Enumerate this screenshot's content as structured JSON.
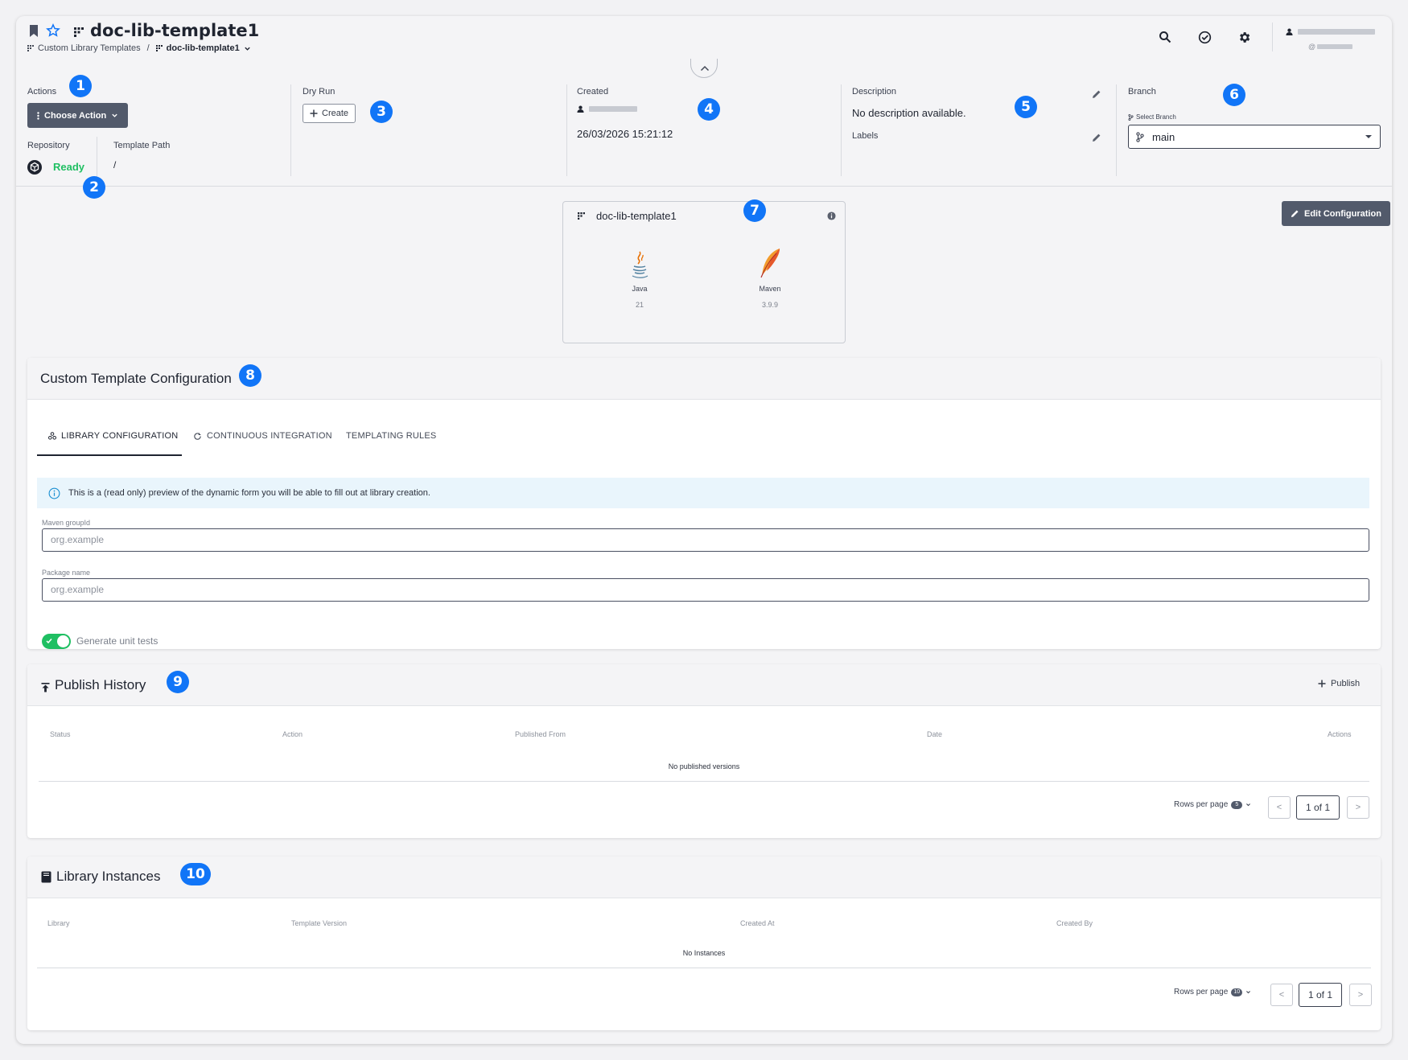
{
  "header": {
    "title": "doc-lib-template1",
    "breadcrumb": {
      "parent": "Custom Library Templates",
      "separator": "/",
      "current": "doc-lib-template1"
    },
    "user_handle": "@"
  },
  "markers": [
    "1",
    "2",
    "3",
    "4",
    "5",
    "6",
    "7",
    "8",
    "9",
    "10"
  ],
  "info_bar": {
    "actions_label": "Actions",
    "choose_action": "Choose Action",
    "repository_label": "Repository",
    "repository_status": "Ready",
    "template_path_label": "Template Path",
    "template_path": "/",
    "dry_run_label": "Dry Run",
    "dry_run_button": "Create",
    "created_label": "Created",
    "created_at": "26/03/2026 15:21:12",
    "description_label": "Description",
    "description": "No description available.",
    "labels_label": "Labels",
    "branch_label": "Branch",
    "select_branch_label": "Select Branch",
    "branch": "main"
  },
  "template_card": {
    "name": "doc-lib-template1",
    "tech": [
      {
        "name": "Java",
        "version": "21"
      },
      {
        "name": "Maven",
        "version": "3.9.9"
      }
    ],
    "edit_button": "Edit Configuration"
  },
  "configuration": {
    "title": "Custom Template Configuration",
    "tabs": [
      "LIBRARY CONFIGURATION",
      "CONTINUOUS INTEGRATION",
      "TEMPLATING RULES"
    ],
    "active_tab": "LIBRARY CONFIGURATION",
    "info_text": "This is a (read only) preview of the dynamic form you will be able to fill out at library creation.",
    "fields": [
      {
        "label": "Maven groupId",
        "placeholder": "org.example"
      },
      {
        "label": "Package name",
        "placeholder": "org.example"
      }
    ],
    "toggle_label": "Generate unit tests",
    "toggle_on": true
  },
  "publish_history": {
    "title": "Publish History",
    "publish_button": "Publish",
    "columns": [
      "Status",
      "Action",
      "Published From",
      "Date",
      "Actions"
    ],
    "empty_text": "No published versions",
    "rows_per_page_label": "Rows per page",
    "rows_per_page": "5",
    "page": "1 of 1",
    "prev": "<",
    "next": ">"
  },
  "library_instances": {
    "title": "Library Instances",
    "columns": [
      "Library",
      "Template Version",
      "Created At",
      "Created By"
    ],
    "empty_text": "No Instances",
    "rows_per_page_label": "Rows per page",
    "rows_per_page": "10",
    "page": "1 of 1",
    "prev": "<",
    "next": ">"
  },
  "colors": {
    "accent": "#1175f7",
    "ready": "#1fbf62",
    "toggle": "#1fbf62",
    "button_dark": "#525a6b",
    "info_bg": "#e9f5fc"
  }
}
